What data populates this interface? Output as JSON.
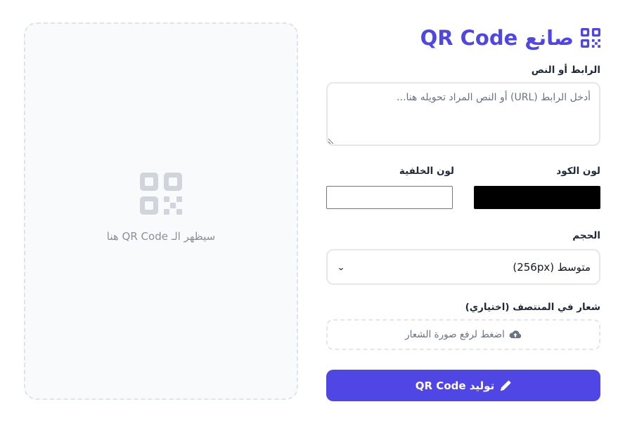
{
  "app": {
    "title": "صانع QR Code",
    "title_icon": "qrcode-icon",
    "accent_color": "#4f46e5"
  },
  "preview": {
    "icon": "qrcode-icon",
    "placeholder_text": "سيظهر الـ QR Code هنا"
  },
  "form": {
    "url_label": "الرابط أو النص",
    "url_value": "",
    "url_placeholder": "أدخل الرابط (URL) أو النص المراد تحويله هنا...",
    "code_color_label": "لون الكود",
    "code_color": "#000000",
    "bg_color_label": "لون الخلفية",
    "bg_color": "#ffffff",
    "size_label": "الحجم",
    "size_value": "متوسط (256px)",
    "logo_label": "شعار في المنتصف (اختياري)",
    "logo_upload_text": "اضغط لرفع صورة الشعار",
    "logo_upload_icon": "cloud-upload-icon",
    "generate_label": "توليد QR Code",
    "generate_icon": "pen-icon"
  }
}
